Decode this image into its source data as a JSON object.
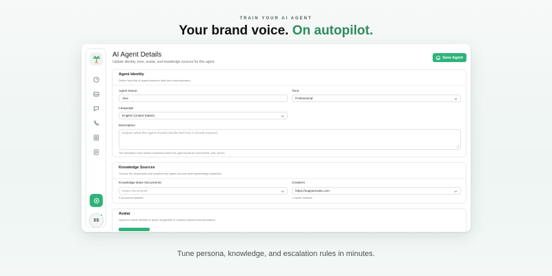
{
  "hero": {
    "eyebrow": "TRAIN YOUR AI AGENT",
    "headline_main": "Your brand voice.",
    "headline_accent": "On autopilot.",
    "footer": "Tune persona, knowledge, and escalation rules in minutes."
  },
  "sidebar": {
    "logo": "palm-tree-icon",
    "items": [
      {
        "icon": "dashboard-icon"
      },
      {
        "icon": "inbox-icon"
      },
      {
        "icon": "chat-icon"
      },
      {
        "icon": "phone-icon"
      },
      {
        "icon": "contacts-icon"
      },
      {
        "icon": "document-icon"
      }
    ],
    "fab_icon": "settings-icon",
    "avatar_initials": "SS"
  },
  "header": {
    "title": "AI Agent Details",
    "subtitle": "Update identity, tone, avatar, and knowledge sources for this agent.",
    "save_label": "Save Agent"
  },
  "identity": {
    "title": "Agent Identity",
    "description": "Define how this AI agent presents itself and communicates.",
    "name_label": "Agent Name",
    "name_value": "Alex",
    "tone_label": "Tone",
    "tone_value": "Professional",
    "language_label": "Language",
    "language_value": "English (United States)",
    "description_label": "Description",
    "description_placeholder": "Explain what this agent should handle and how it should respond.",
    "description_help": "This description helps admins understand where this agent should be used (tickets, chat, phone)."
  },
  "knowledge": {
    "title": "Knowledge Sources",
    "description": "Choose the documents and crawlers this agent can use when generating responses.",
    "kb_label": "Knowledge Base Documents",
    "kb_placeholder": "Select documents",
    "kb_help": "0 documents available",
    "crawlers_label": "Crawlers",
    "crawlers_value": "https://supportcasts.com",
    "crawlers_help": "1 crawler available"
  },
  "avatar": {
    "title": "Avatar",
    "description": "Upload a visual identity for quick recognition in channel pickers and summaries."
  },
  "colors": {
    "accent": "#2fb37a",
    "headline_accent": "#2f8a5c"
  }
}
